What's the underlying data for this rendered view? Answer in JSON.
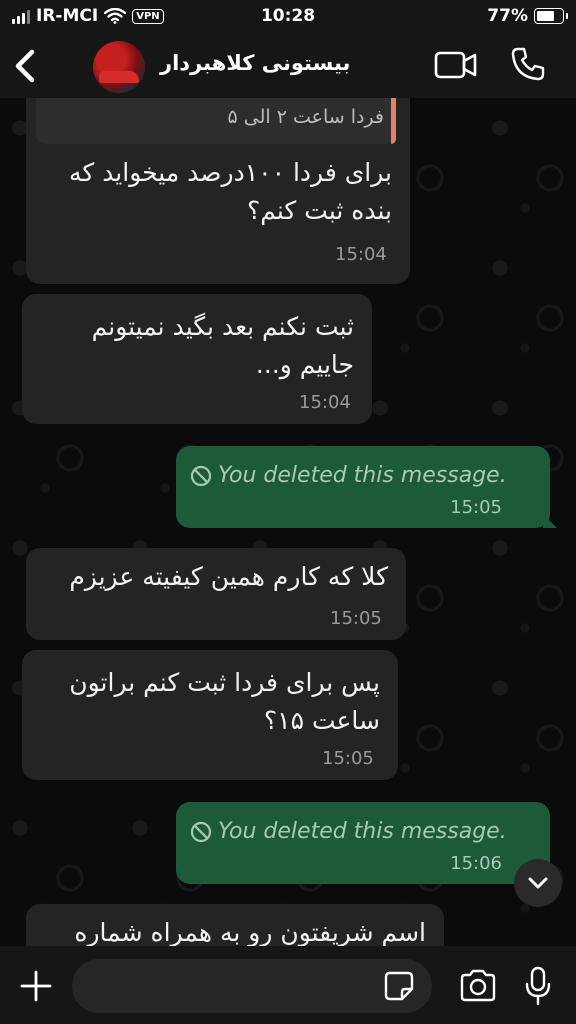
{
  "status_bar": {
    "carrier": "IR-MCI",
    "vpn": "VPN",
    "time": "10:28",
    "battery": "77%",
    "battery_level": 0.77
  },
  "header": {
    "contact_name": "بیستونی کلاهبردار",
    "back_icon": "chevron-left-icon",
    "video_icon": "video-camera-icon",
    "call_icon": "phone-icon"
  },
  "messages": [
    {
      "direction": "in",
      "quote": "فردا ساعت ۲ الی ۵",
      "line1": "برای فردا ۱۰۰درصد میخواید که",
      "line2": "بنده ثبت کنم؟",
      "time": "15:04"
    },
    {
      "direction": "in",
      "line1": "ثبت نکنم بعد بگید نمیتونم",
      "line2": "جاییم و...",
      "time": "15:04"
    },
    {
      "direction": "out",
      "text": "You deleted this message.",
      "time": "15:05"
    },
    {
      "direction": "in",
      "line1": "کلا که کارم همین کیفیته عزیزم",
      "time": "15:05"
    },
    {
      "direction": "in",
      "line1": "پس برای فردا ثبت کنم براتون",
      "line2": "ساعت ۱۵؟",
      "time": "15:05"
    },
    {
      "direction": "out",
      "text": "You deleted this message.",
      "time": "15:06"
    },
    {
      "direction": "in",
      "line1": "اسم شریفتون رو به همراه شماره"
    }
  ],
  "input": {
    "placeholder": "",
    "plus_icon": "plus-icon",
    "sticker_icon": "sticker-icon",
    "camera_icon": "camera-icon",
    "mic_icon": "microphone-icon"
  },
  "colors": {
    "outgoing_bubble": "#1c5a3a",
    "incoming_bubble": "#242424",
    "quote_accent": "#e8816a"
  }
}
